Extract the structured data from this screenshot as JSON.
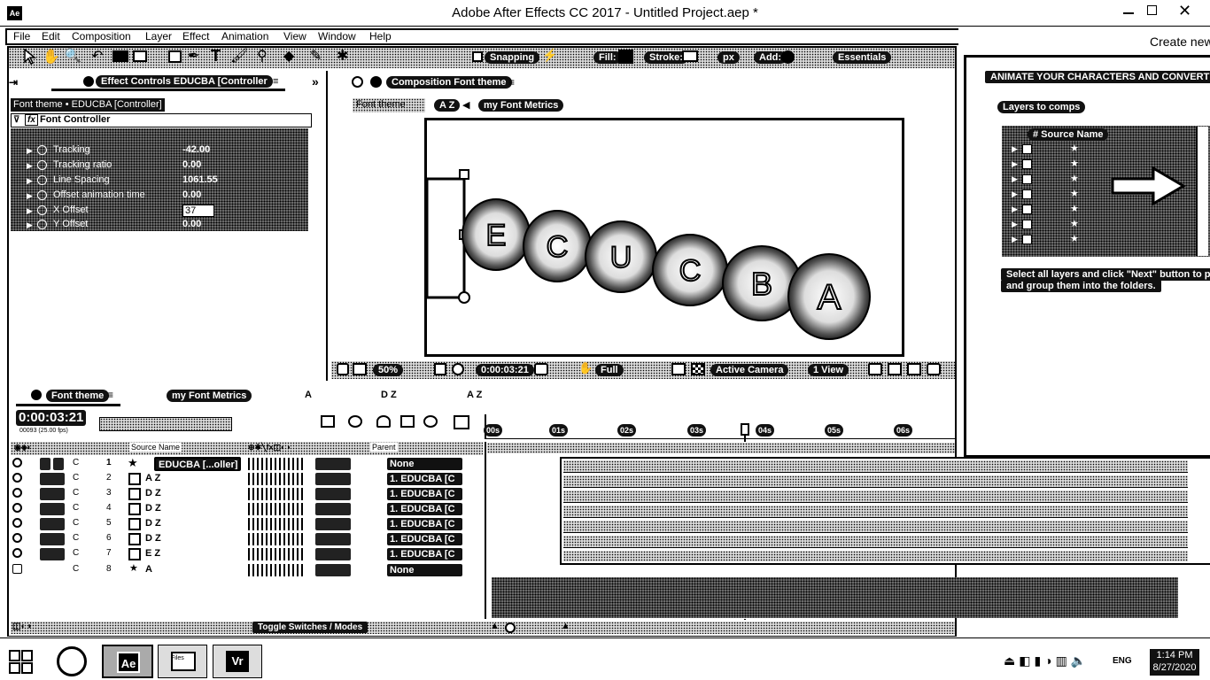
{
  "window": {
    "title": "Adobe After Effects CC 2017 - Untitled Project.aep *",
    "app_icon": "Ae"
  },
  "menu": [
    "File",
    "Edit",
    "Composition",
    "Layer",
    "Effect",
    "Animation",
    "View",
    "Window",
    "Help"
  ],
  "create_new": "Create new",
  "toolbar": {
    "snapping": "Snapping",
    "fill": "Fill:",
    "stroke": "Stroke:",
    "px": "px",
    "add": "Add:",
    "workspace": "Essentials"
  },
  "effect_controls": {
    "tab": "Effect Controls EDUCBA [Controller",
    "breadcrumb": "Font theme • EDUCBA [Controller]",
    "effect": "Font Controller",
    "params": [
      {
        "name": "Tracking",
        "value": "-42.00"
      },
      {
        "name": "Tracking ratio",
        "value": "0.00"
      },
      {
        "name": "Line Spacing",
        "value": "1061.55"
      },
      {
        "name": "Offset animation time",
        "value": "0.00"
      },
      {
        "name": "X Offset",
        "value": "37"
      },
      {
        "name": "Y Offset",
        "value": "0.00"
      }
    ]
  },
  "composition": {
    "tab": "Composition Font theme",
    "subtabs": [
      "Font theme",
      "A Z",
      "my Font Metrics"
    ],
    "letters": [
      "E",
      "C",
      "U",
      "C",
      "B",
      "A"
    ],
    "footer": {
      "zoom": "50%",
      "timecode": "0:00:03:21",
      "resolution": "Full",
      "camera": "Active Camera",
      "view": "1 View"
    }
  },
  "right_panel": {
    "title": "ANIMATE YOUR CHARACTERS AND CONVERT LAY",
    "subtitle": "Layers to comps",
    "col_header": "# Source Name",
    "description_line1": "Select all layers and click \"Next\" button to place",
    "description_line2": "and group them into the folders."
  },
  "timeline": {
    "tabs": [
      "Font theme",
      "my Font Metrics",
      "A",
      "D Z",
      "A Z"
    ],
    "timecode": "0:00:03:21",
    "timecode_sub": "00093 (25.00 fps)",
    "header": {
      "source_name": "Source Name",
      "parent": "Parent"
    },
    "ruler": [
      "00s",
      "01s",
      "02s",
      "03s",
      "04s",
      "05s",
      "06s"
    ],
    "layers": [
      {
        "num": "1",
        "name": "EDUCBA [...oller]",
        "parent": "None"
      },
      {
        "num": "2",
        "name": "A Z",
        "parent": "1. EDUCBA [C"
      },
      {
        "num": "3",
        "name": "D Z",
        "parent": "1. EDUCBA [C"
      },
      {
        "num": "4",
        "name": "D Z",
        "parent": "1. EDUCBA [C"
      },
      {
        "num": "5",
        "name": "D Z",
        "parent": "1. EDUCBA [C"
      },
      {
        "num": "6",
        "name": "D Z",
        "parent": "1. EDUCBA [C"
      },
      {
        "num": "7",
        "name": "E Z",
        "parent": "1. EDUCBA [C"
      },
      {
        "num": "8",
        "name": "A",
        "parent": "None"
      }
    ],
    "toggle": "Toggle Switches / Modes"
  },
  "taskbar": {
    "apps": [
      "Ae",
      "Files",
      "Vr"
    ],
    "time": "1:14 PM",
    "date": "8/27/2020",
    "lang": "ENG"
  }
}
